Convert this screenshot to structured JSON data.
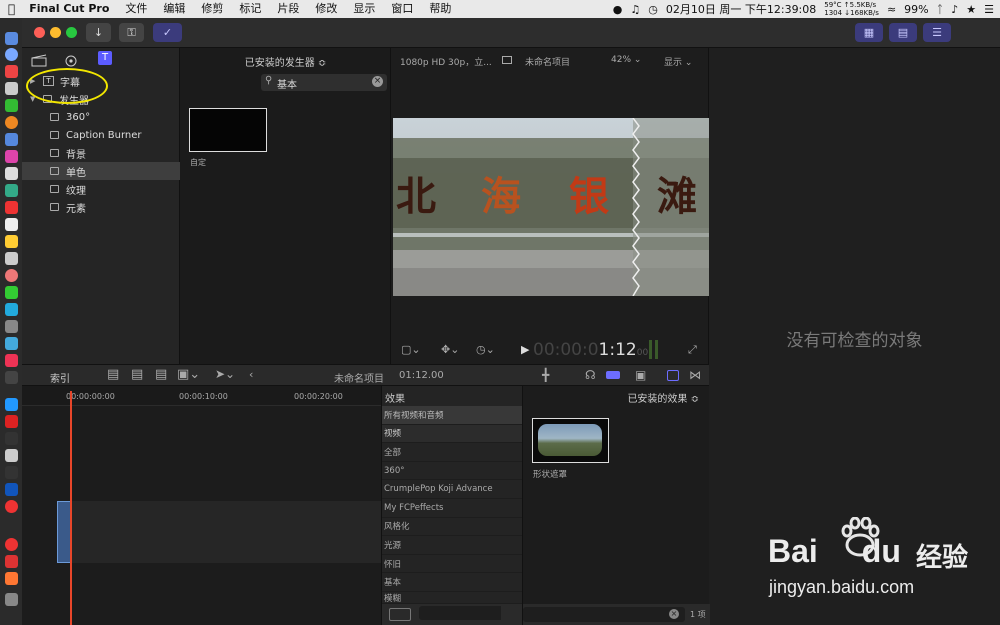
{
  "menubar": {
    "apple": "",
    "app_name": "Final Cut Pro",
    "items": [
      "文件",
      "编辑",
      "修剪",
      "标记",
      "片段",
      "修改",
      "显示",
      "窗口",
      "帮助"
    ],
    "net_line1": "59°C ↑5.5KB/s",
    "net_line2": "1304 ↓168KB/s",
    "battery": "99%",
    "datetime": "02月10日 周一 下午12:39:08"
  },
  "sidebar": {
    "items": [
      {
        "label": "字幕",
        "expander": "▶"
      },
      {
        "label": "发生器",
        "expander": "▼"
      },
      {
        "label": "360°"
      },
      {
        "label": "Caption Burner"
      },
      {
        "label": "背景"
      },
      {
        "label": "单色"
      },
      {
        "label": "纹理"
      },
      {
        "label": "元素"
      }
    ]
  },
  "browser": {
    "header": "已安装的发生器 ≎",
    "search_value": "基本",
    "thumb_label": "自定"
  },
  "viewer": {
    "format": "1080p HD 30p，立...",
    "project": "未命名项目",
    "zoom": "42% ⌄",
    "view_menu": "显示 ⌄",
    "video_text": [
      "北",
      "海",
      "银",
      "滩"
    ],
    "timecode_dim": "00:00:0",
    "timecode_bright": "1:12",
    "timecode_frames": "00"
  },
  "inspector": {
    "empty_text": "没有可检查的对象"
  },
  "timeline": {
    "index_label": "索引",
    "project": "未命名项目",
    "duration": "01:12.00",
    "ruler": [
      "00:00:00:00",
      "00:00:10:00",
      "00:00:20:00"
    ]
  },
  "effects": {
    "header": "效果",
    "installed": "已安装的效果 ≎",
    "list": [
      "所有视频和音频",
      "视频",
      "全部",
      "360°",
      "CrumplePop Koji Advance",
      "My FCPeffects",
      "风格化",
      "光源",
      "怀旧",
      "基本",
      "模糊"
    ],
    "thumb_label": "形状遮罩",
    "search_value": "形状",
    "count": "1 项"
  },
  "watermark": {
    "brand": "Bai",
    "brand2": "du",
    "cn": "经验",
    "url": "jingyan.baidu.com"
  },
  "colors": {
    "accent": "#6d6dff",
    "playhead": "#e8462a",
    "highlight_ring": "#f2e600"
  }
}
